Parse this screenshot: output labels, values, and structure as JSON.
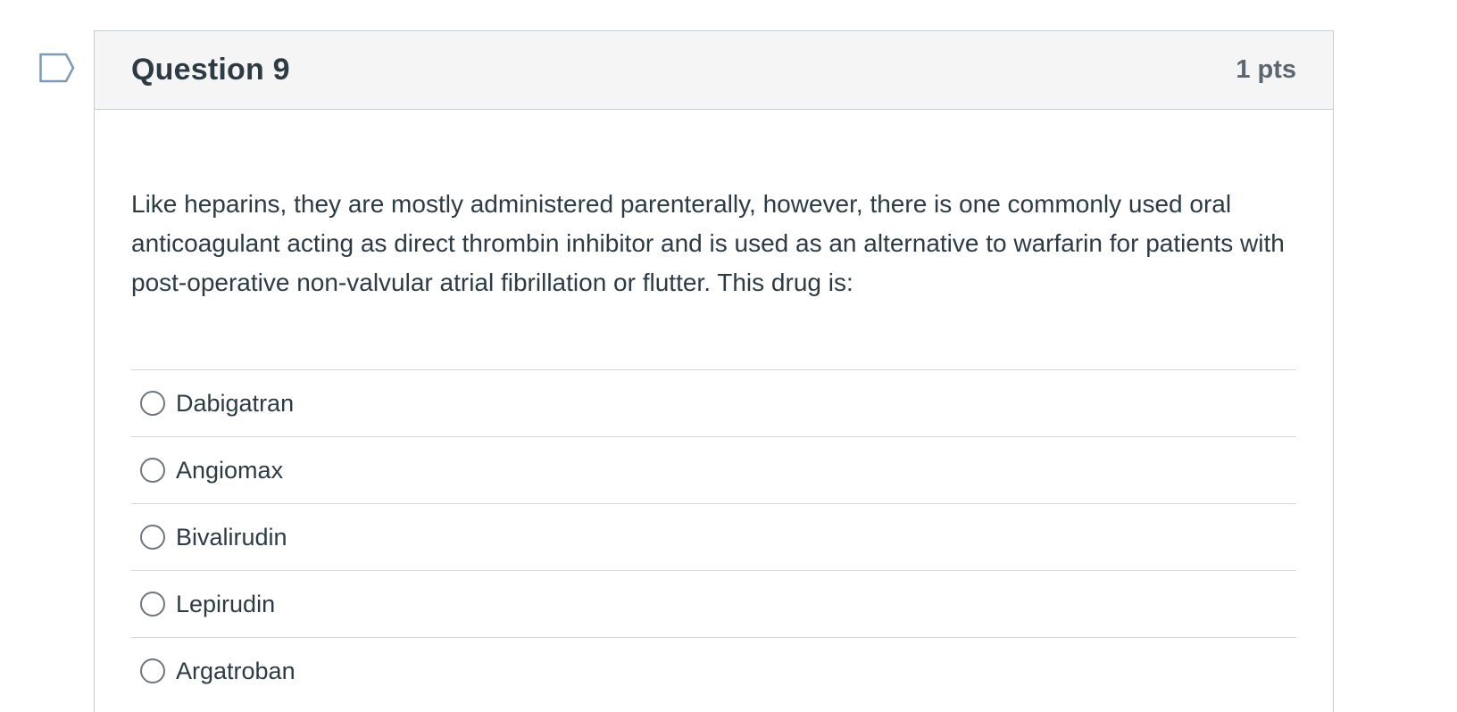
{
  "question": {
    "title": "Question 9",
    "points": "1 pts",
    "text": "Like heparins, they are mostly administered parenterally, however, there is one commonly used oral anticoagulant acting as direct thrombin inhibitor and is used as an alternative to warfarin for patients with post-operative non-valvular atrial fibrillation or flutter.  This drug is:",
    "answers": [
      {
        "label": "Dabigatran",
        "selected": false
      },
      {
        "label": "Angiomax",
        "selected": false
      },
      {
        "label": "Bivalirudin",
        "selected": false
      },
      {
        "label": "Lepirudin",
        "selected": false
      },
      {
        "label": "Argatroban",
        "selected": false
      }
    ]
  },
  "icons": {
    "flag": "flag-question-icon",
    "radio": "radio-unchecked-icon"
  },
  "colors": {
    "header_bg": "#f5f5f5",
    "border": "#c7cdd1",
    "text": "#2d3b45",
    "points": "#5b6670",
    "flag_stroke": "#7a9ab5"
  }
}
